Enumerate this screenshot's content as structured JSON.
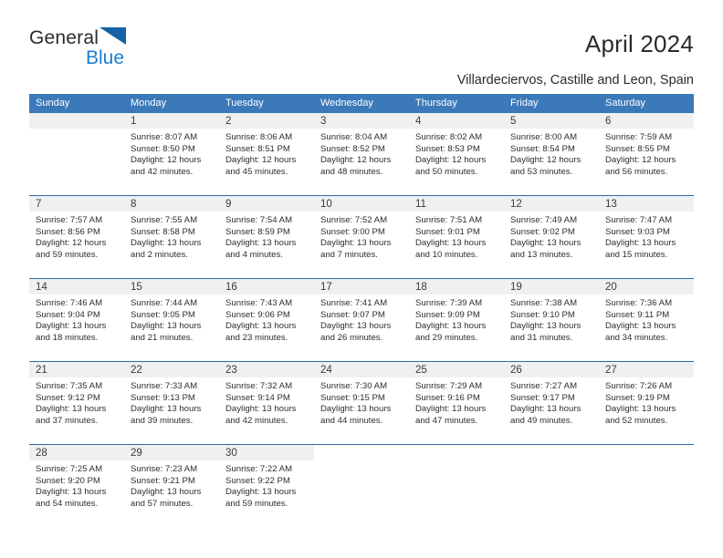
{
  "brand": {
    "word1": "General",
    "word2": "Blue",
    "logo_icon": "blue-triangle-logo"
  },
  "header": {
    "title": "April 2024",
    "location": "Villardeciervos, Castille and Leon, Spain"
  },
  "colors": {
    "header_blue": "#3b79b8",
    "row_divider": "#2f6ba5",
    "daynum_bg": "#f0f0f0",
    "brand_blue": "#1b7fd4",
    "text": "#2b2b2b"
  },
  "calendar": {
    "weekdays": [
      "Sunday",
      "Monday",
      "Tuesday",
      "Wednesday",
      "Thursday",
      "Friday",
      "Saturday"
    ],
    "weeks": [
      [
        {
          "day": "",
          "sunrise": "",
          "sunset": "",
          "daylight1": "",
          "daylight2": "",
          "empty": true
        },
        {
          "day": "1",
          "sunrise": "Sunrise: 8:07 AM",
          "sunset": "Sunset: 8:50 PM",
          "daylight1": "Daylight: 12 hours",
          "daylight2": "and 42 minutes."
        },
        {
          "day": "2",
          "sunrise": "Sunrise: 8:06 AM",
          "sunset": "Sunset: 8:51 PM",
          "daylight1": "Daylight: 12 hours",
          "daylight2": "and 45 minutes."
        },
        {
          "day": "3",
          "sunrise": "Sunrise: 8:04 AM",
          "sunset": "Sunset: 8:52 PM",
          "daylight1": "Daylight: 12 hours",
          "daylight2": "and 48 minutes."
        },
        {
          "day": "4",
          "sunrise": "Sunrise: 8:02 AM",
          "sunset": "Sunset: 8:53 PM",
          "daylight1": "Daylight: 12 hours",
          "daylight2": "and 50 minutes."
        },
        {
          "day": "5",
          "sunrise": "Sunrise: 8:00 AM",
          "sunset": "Sunset: 8:54 PM",
          "daylight1": "Daylight: 12 hours",
          "daylight2": "and 53 minutes."
        },
        {
          "day": "6",
          "sunrise": "Sunrise: 7:59 AM",
          "sunset": "Sunset: 8:55 PM",
          "daylight1": "Daylight: 12 hours",
          "daylight2": "and 56 minutes."
        }
      ],
      [
        {
          "day": "7",
          "sunrise": "Sunrise: 7:57 AM",
          "sunset": "Sunset: 8:56 PM",
          "daylight1": "Daylight: 12 hours",
          "daylight2": "and 59 minutes."
        },
        {
          "day": "8",
          "sunrise": "Sunrise: 7:55 AM",
          "sunset": "Sunset: 8:58 PM",
          "daylight1": "Daylight: 13 hours",
          "daylight2": "and 2 minutes."
        },
        {
          "day": "9",
          "sunrise": "Sunrise: 7:54 AM",
          "sunset": "Sunset: 8:59 PM",
          "daylight1": "Daylight: 13 hours",
          "daylight2": "and 4 minutes."
        },
        {
          "day": "10",
          "sunrise": "Sunrise: 7:52 AM",
          "sunset": "Sunset: 9:00 PM",
          "daylight1": "Daylight: 13 hours",
          "daylight2": "and 7 minutes."
        },
        {
          "day": "11",
          "sunrise": "Sunrise: 7:51 AM",
          "sunset": "Sunset: 9:01 PM",
          "daylight1": "Daylight: 13 hours",
          "daylight2": "and 10 minutes."
        },
        {
          "day": "12",
          "sunrise": "Sunrise: 7:49 AM",
          "sunset": "Sunset: 9:02 PM",
          "daylight1": "Daylight: 13 hours",
          "daylight2": "and 13 minutes."
        },
        {
          "day": "13",
          "sunrise": "Sunrise: 7:47 AM",
          "sunset": "Sunset: 9:03 PM",
          "daylight1": "Daylight: 13 hours",
          "daylight2": "and 15 minutes."
        }
      ],
      [
        {
          "day": "14",
          "sunrise": "Sunrise: 7:46 AM",
          "sunset": "Sunset: 9:04 PM",
          "daylight1": "Daylight: 13 hours",
          "daylight2": "and 18 minutes."
        },
        {
          "day": "15",
          "sunrise": "Sunrise: 7:44 AM",
          "sunset": "Sunset: 9:05 PM",
          "daylight1": "Daylight: 13 hours",
          "daylight2": "and 21 minutes."
        },
        {
          "day": "16",
          "sunrise": "Sunrise: 7:43 AM",
          "sunset": "Sunset: 9:06 PM",
          "daylight1": "Daylight: 13 hours",
          "daylight2": "and 23 minutes."
        },
        {
          "day": "17",
          "sunrise": "Sunrise: 7:41 AM",
          "sunset": "Sunset: 9:07 PM",
          "daylight1": "Daylight: 13 hours",
          "daylight2": "and 26 minutes."
        },
        {
          "day": "18",
          "sunrise": "Sunrise: 7:39 AM",
          "sunset": "Sunset: 9:09 PM",
          "daylight1": "Daylight: 13 hours",
          "daylight2": "and 29 minutes."
        },
        {
          "day": "19",
          "sunrise": "Sunrise: 7:38 AM",
          "sunset": "Sunset: 9:10 PM",
          "daylight1": "Daylight: 13 hours",
          "daylight2": "and 31 minutes."
        },
        {
          "day": "20",
          "sunrise": "Sunrise: 7:36 AM",
          "sunset": "Sunset: 9:11 PM",
          "daylight1": "Daylight: 13 hours",
          "daylight2": "and 34 minutes."
        }
      ],
      [
        {
          "day": "21",
          "sunrise": "Sunrise: 7:35 AM",
          "sunset": "Sunset: 9:12 PM",
          "daylight1": "Daylight: 13 hours",
          "daylight2": "and 37 minutes."
        },
        {
          "day": "22",
          "sunrise": "Sunrise: 7:33 AM",
          "sunset": "Sunset: 9:13 PM",
          "daylight1": "Daylight: 13 hours",
          "daylight2": "and 39 minutes."
        },
        {
          "day": "23",
          "sunrise": "Sunrise: 7:32 AM",
          "sunset": "Sunset: 9:14 PM",
          "daylight1": "Daylight: 13 hours",
          "daylight2": "and 42 minutes."
        },
        {
          "day": "24",
          "sunrise": "Sunrise: 7:30 AM",
          "sunset": "Sunset: 9:15 PM",
          "daylight1": "Daylight: 13 hours",
          "daylight2": "and 44 minutes."
        },
        {
          "day": "25",
          "sunrise": "Sunrise: 7:29 AM",
          "sunset": "Sunset: 9:16 PM",
          "daylight1": "Daylight: 13 hours",
          "daylight2": "and 47 minutes."
        },
        {
          "day": "26",
          "sunrise": "Sunrise: 7:27 AM",
          "sunset": "Sunset: 9:17 PM",
          "daylight1": "Daylight: 13 hours",
          "daylight2": "and 49 minutes."
        },
        {
          "day": "27",
          "sunrise": "Sunrise: 7:26 AM",
          "sunset": "Sunset: 9:19 PM",
          "daylight1": "Daylight: 13 hours",
          "daylight2": "and 52 minutes."
        }
      ],
      [
        {
          "day": "28",
          "sunrise": "Sunrise: 7:25 AM",
          "sunset": "Sunset: 9:20 PM",
          "daylight1": "Daylight: 13 hours",
          "daylight2": "and 54 minutes."
        },
        {
          "day": "29",
          "sunrise": "Sunrise: 7:23 AM",
          "sunset": "Sunset: 9:21 PM",
          "daylight1": "Daylight: 13 hours",
          "daylight2": "and 57 minutes."
        },
        {
          "day": "30",
          "sunrise": "Sunrise: 7:22 AM",
          "sunset": "Sunset: 9:22 PM",
          "daylight1": "Daylight: 13 hours",
          "daylight2": "and 59 minutes."
        },
        {
          "day": "",
          "sunrise": "",
          "sunset": "",
          "daylight1": "",
          "daylight2": "",
          "empty": true,
          "blank": true
        },
        {
          "day": "",
          "sunrise": "",
          "sunset": "",
          "daylight1": "",
          "daylight2": "",
          "empty": true,
          "blank": true
        },
        {
          "day": "",
          "sunrise": "",
          "sunset": "",
          "daylight1": "",
          "daylight2": "",
          "empty": true,
          "blank": true
        },
        {
          "day": "",
          "sunrise": "",
          "sunset": "",
          "daylight1": "",
          "daylight2": "",
          "empty": true,
          "blank": true
        }
      ]
    ]
  }
}
